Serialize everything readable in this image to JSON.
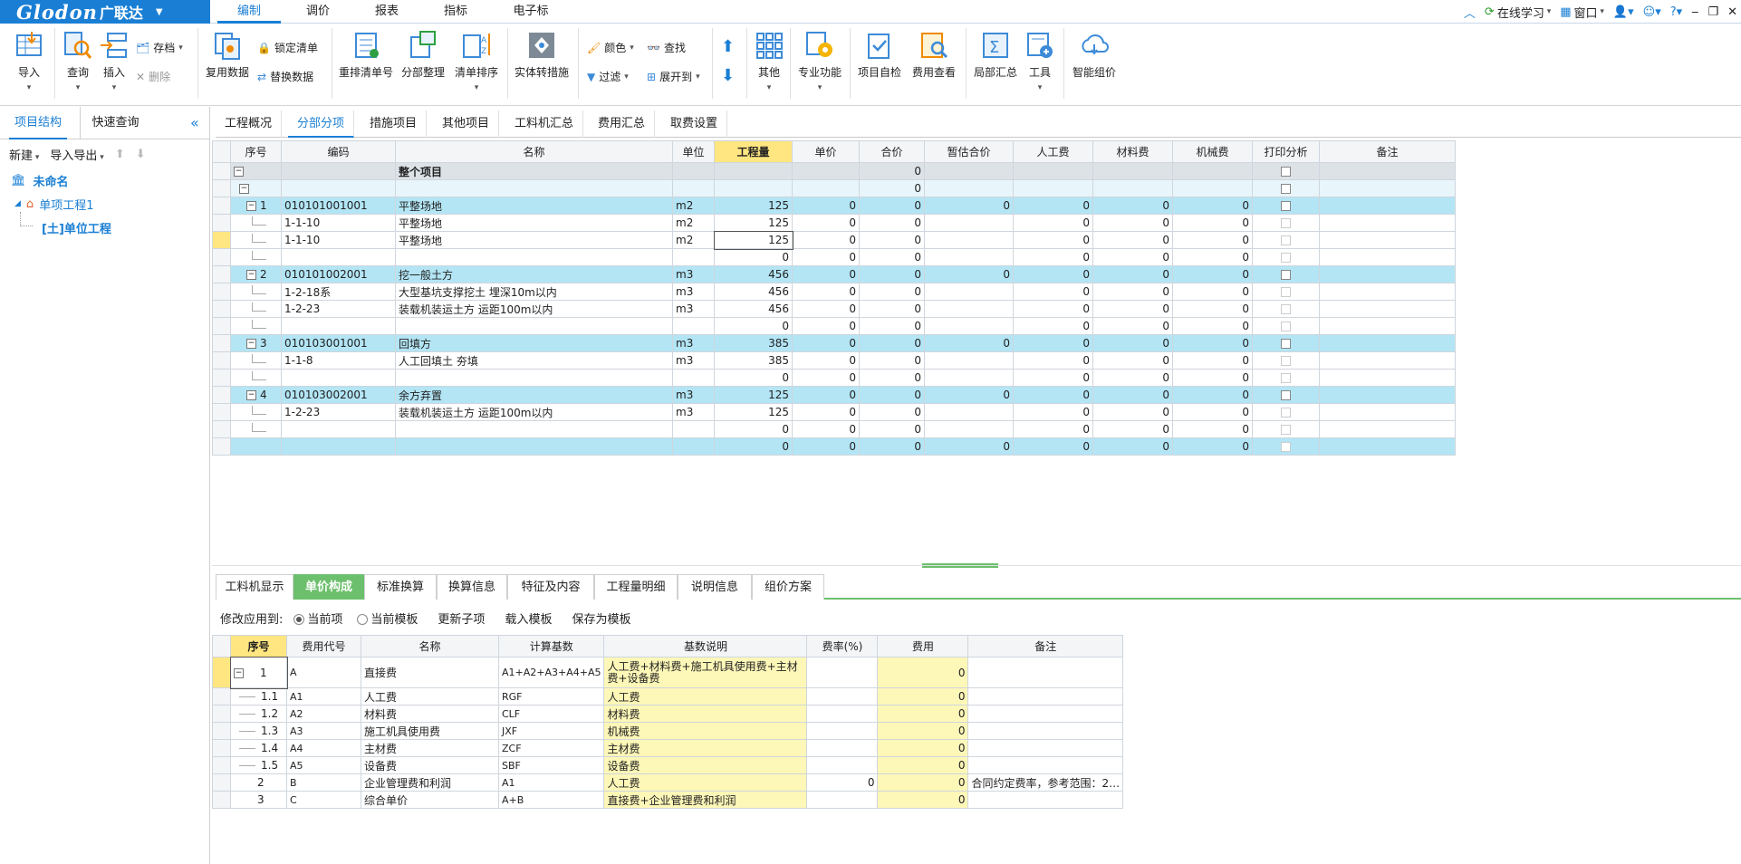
{
  "app": {
    "logo_en": "Glodon",
    "logo_cn": "广联达",
    "menu_tabs": [
      "编制",
      "调价",
      "报表",
      "指标",
      "电子标"
    ],
    "right_tools": {
      "online_learning": "在线学习",
      "window": "窗口"
    }
  },
  "ribbon": {
    "import": "导入",
    "query": "查询",
    "insert": "插入",
    "archive": "存档",
    "delete": "删除",
    "reuse_data": "复用数据",
    "lock_list": "锁定清单",
    "replace_data": "替换数据",
    "renumber": "重排清单号",
    "section_arrange": "分部整理",
    "list_sort": "清单排序",
    "entity_to_measure": "实体转措施",
    "color": "颜色",
    "find": "查找",
    "filter": "过滤",
    "expand_to": "展开到",
    "other": "其他",
    "professional": "专业功能",
    "self_check": "项目自检",
    "fee_check": "费用查看",
    "partial_summary": "局部汇总",
    "tools": "工具",
    "smart_pricing": "智能组价"
  },
  "left_panel": {
    "tabs": [
      "项目结构",
      "快速查询"
    ],
    "new": "新建",
    "import_export": "导入导出",
    "tree": {
      "root": "未命名",
      "child": "单项工程1",
      "leaf": "[土]单位工程"
    }
  },
  "main_tabs": [
    "工程概况",
    "分部分项",
    "措施项目",
    "其他项目",
    "工料机汇总",
    "费用汇总",
    "取费设置"
  ],
  "grid": {
    "headers": [
      "序号",
      "编码",
      "名称",
      "单位",
      "工程量",
      "单价",
      "合价",
      "暂估合价",
      "人工费",
      "材料费",
      "机械费",
      "打印分析",
      "备注"
    ],
    "rows": [
      {
        "t": "whole",
        "seq": "",
        "code": "",
        "name": "整个项目",
        "unit": "",
        "qty": "",
        "price": "",
        "total": "0",
        "est": "",
        "labor": "",
        "mat": "",
        "mach": ""
      },
      {
        "t": "sub",
        "seq": "",
        "code": "",
        "name": "",
        "unit": "",
        "qty": "",
        "price": "",
        "total": "0",
        "est": "",
        "labor": "",
        "mat": "",
        "mach": ""
      },
      {
        "t": "item",
        "seq": "1",
        "code": "010101001001",
        "name": "平整场地",
        "unit": "m2",
        "qty": "125",
        "price": "0",
        "total": "0",
        "est": "0",
        "labor": "0",
        "mat": "0",
        "mach": "0"
      },
      {
        "t": "quota",
        "seq": "",
        "code": "1-1-10",
        "name": "平整场地",
        "unit": "m2",
        "qty": "125",
        "price": "0",
        "total": "0",
        "est": "",
        "labor": "0",
        "mat": "0",
        "mach": "0"
      },
      {
        "t": "quota",
        "seq": "",
        "code": "1-1-10",
        "name": "平整场地",
        "unit": "m2",
        "qty": "125",
        "price": "0",
        "total": "0",
        "est": "",
        "labor": "0",
        "mat": "0",
        "mach": "0",
        "sel": true
      },
      {
        "t": "blank",
        "seq": "",
        "code": "",
        "name": "",
        "unit": "",
        "qty": "0",
        "price": "0",
        "total": "0",
        "est": "",
        "labor": "0",
        "mat": "0",
        "mach": "0"
      },
      {
        "t": "item",
        "seq": "2",
        "code": "010101002001",
        "name": "挖一般土方",
        "unit": "m3",
        "qty": "456",
        "price": "0",
        "total": "0",
        "est": "0",
        "labor": "0",
        "mat": "0",
        "mach": "0"
      },
      {
        "t": "quota",
        "seq": "",
        "code": "1-2-18系",
        "name": "大型基坑支撑挖土 埋深10m以内",
        "unit": "m3",
        "qty": "456",
        "price": "0",
        "total": "0",
        "est": "",
        "labor": "0",
        "mat": "0",
        "mach": "0"
      },
      {
        "t": "quota",
        "seq": "",
        "code": "1-2-23",
        "name": "装载机装运土方 运距100m以内",
        "unit": "m3",
        "qty": "456",
        "price": "0",
        "total": "0",
        "est": "",
        "labor": "0",
        "mat": "0",
        "mach": "0"
      },
      {
        "t": "blank",
        "seq": "",
        "code": "",
        "name": "",
        "unit": "",
        "qty": "0",
        "price": "0",
        "total": "0",
        "est": "",
        "labor": "0",
        "mat": "0",
        "mach": "0"
      },
      {
        "t": "item",
        "seq": "3",
        "code": "010103001001",
        "name": "回填方",
        "unit": "m3",
        "qty": "385",
        "price": "0",
        "total": "0",
        "est": "0",
        "labor": "0",
        "mat": "0",
        "mach": "0"
      },
      {
        "t": "quota",
        "seq": "",
        "code": "1-1-8",
        "name": "人工回填土 夯填",
        "unit": "m3",
        "qty": "385",
        "price": "0",
        "total": "0",
        "est": "",
        "labor": "0",
        "mat": "0",
        "mach": "0"
      },
      {
        "t": "blank",
        "seq": "",
        "code": "",
        "name": "",
        "unit": "",
        "qty": "0",
        "price": "0",
        "total": "0",
        "est": "",
        "labor": "0",
        "mat": "0",
        "mach": "0"
      },
      {
        "t": "item",
        "seq": "4",
        "code": "010103002001",
        "name": "余方弃置",
        "unit": "m3",
        "qty": "125",
        "price": "0",
        "total": "0",
        "est": "0",
        "labor": "0",
        "mat": "0",
        "mach": "0"
      },
      {
        "t": "quota",
        "seq": "",
        "code": "1-2-23",
        "name": "装载机装运土方 运距100m以内",
        "unit": "m3",
        "qty": "125",
        "price": "0",
        "total": "0",
        "est": "",
        "labor": "0",
        "mat": "0",
        "mach": "0"
      },
      {
        "t": "blank",
        "seq": "",
        "code": "",
        "name": "",
        "unit": "",
        "qty": "0",
        "price": "0",
        "total": "0",
        "est": "",
        "labor": "0",
        "mat": "0",
        "mach": "0"
      },
      {
        "t": "total",
        "seq": "",
        "code": "",
        "name": "",
        "unit": "",
        "qty": "0",
        "price": "0",
        "total": "0",
        "est": "0",
        "labor": "0",
        "mat": "0",
        "mach": "0"
      }
    ]
  },
  "bottom_tabs": [
    "工料机显示",
    "单价构成",
    "标准换算",
    "换算信息",
    "特征及内容",
    "工程量明细",
    "说明信息",
    "组价方案"
  ],
  "bottom_opts": {
    "apply_to": "修改应用到:",
    "current_item": "当前项",
    "current_template": "当前模板",
    "update_sub": "更新子项",
    "load_template": "载入模板",
    "save_template": "保存为模板"
  },
  "price_grid": {
    "headers": [
      "序号",
      "费用代号",
      "名称",
      "计算基数",
      "基数说明",
      "费率(%)",
      "费用",
      "备注"
    ],
    "rows": [
      {
        "seq": "1",
        "code": "A",
        "name": "直接费",
        "base": "A1+A2+A3+A4+A5",
        "desc": "人工费+材料费+施工机具使用费+主材费+设备费",
        "rate": "",
        "fee": "0",
        "note": "",
        "tall": true
      },
      {
        "seq": "1.1",
        "code": "A1",
        "name": "人工费",
        "base": "RGF",
        "desc": "人工费",
        "rate": "",
        "fee": "0",
        "note": ""
      },
      {
        "seq": "1.2",
        "code": "A2",
        "name": "材料费",
        "base": "CLF",
        "desc": "材料费",
        "rate": "",
        "fee": "0",
        "note": ""
      },
      {
        "seq": "1.3",
        "code": "A3",
        "name": "施工机具使用费",
        "base": "JXF",
        "desc": "机械费",
        "rate": "",
        "fee": "0",
        "note": ""
      },
      {
        "seq": "1.4",
        "code": "A4",
        "name": "主材费",
        "base": "ZCF",
        "desc": "主材费",
        "rate": "",
        "fee": "0",
        "note": ""
      },
      {
        "seq": "1.5",
        "code": "A5",
        "name": "设备费",
        "base": "SBF",
        "desc": "设备费",
        "rate": "",
        "fee": "0",
        "note": ""
      },
      {
        "seq": "2",
        "code": "B",
        "name": "企业管理费和利润",
        "base": "A1",
        "desc": "人工费",
        "rate": "0",
        "fee": "0",
        "note": "合同约定费率，参考范围：2…"
      },
      {
        "seq": "3",
        "code": "C",
        "name": "综合单价",
        "base": "A+B",
        "desc": "直接费+企业管理费和利润",
        "rate": "",
        "fee": "0",
        "note": ""
      }
    ]
  },
  "colors": {
    "brand": "#1a7fd4",
    "row_highlight": "#b3e5f5",
    "active_tab_green": "#6cbf6c",
    "yellow_cell": "#fdf7b8"
  }
}
